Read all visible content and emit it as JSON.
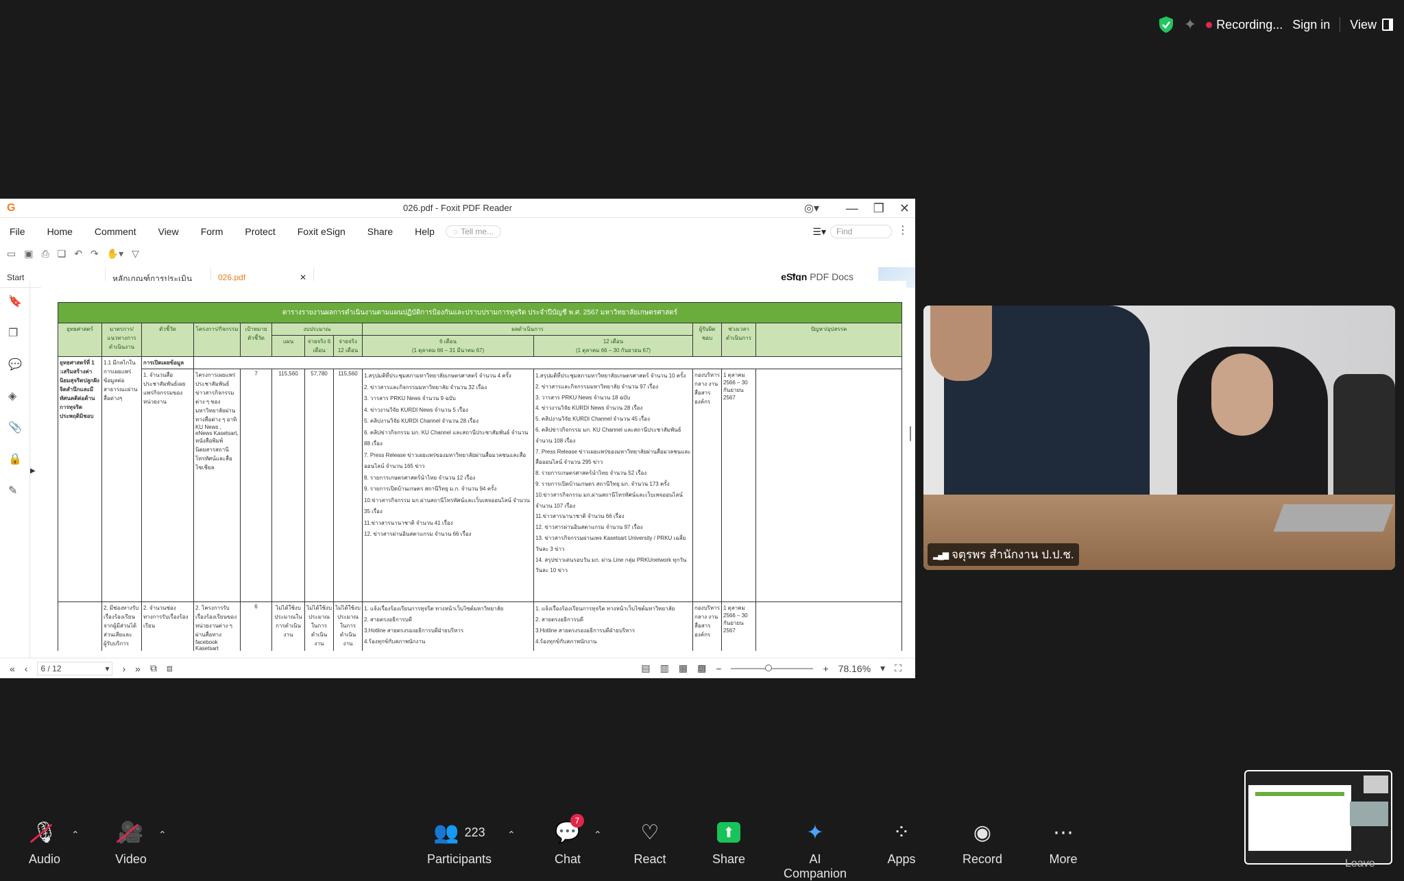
{
  "topbar": {
    "recording": "Recording...",
    "sign_in": "Sign in",
    "view": "View"
  },
  "foxit": {
    "title": "026.pdf - Foxit PDF Reader",
    "menu": [
      "File",
      "Home",
      "Comment",
      "View",
      "Form",
      "Protect",
      "Foxit eSign",
      "Share",
      "Help"
    ],
    "tell_me": "Tell me...",
    "find": "Find",
    "tabs": [
      "Start",
      "หลักเกณฑ์การประเมิน ITA ...",
      "026.pdf"
    ],
    "esign_brand": "eSign",
    "esign_rest": "PDF Docs",
    "page": "6 / 12",
    "zoom": "78.16%"
  },
  "pdf": {
    "title": "ตารางรายงานผลการดำเนินงานตามแผนปฏิบัติการป้องกันและปราบปรามการทุจริต ประจำปีบัญชี พ.ศ. 2567  มหาวิทยาลัยเกษตรศาสตร์",
    "headers": {
      "strategy": "ยุทธศาสตร์",
      "measure": "มาตรการ/แนวทางการดำเนินงาน",
      "indicator": "ตัวชี้วัด",
      "project": "โครงการ/กิจกรรม",
      "target": "เป้าหมายตัวชี้วัด",
      "budget": "งบประมาณ",
      "plan": "แผน",
      "spend6": "จ่ายจริง 6 เดือน",
      "spend12": "จ่ายจริง 12 เดือน",
      "result": "ผลดำเนินการ",
      "m6": "6 เดือน",
      "m6sub": "(1 ตุลาคม 66 – 31 มีนาคม 67)",
      "m12": "12 เดือน",
      "m12sub": "(1 ตุลาคม 66 – 30 กันยายน 67)",
      "owner": "ผู้รับผิดชอบ",
      "period": "ช่วงเวลาดำเนินการ",
      "problem": "ปัญหา/อุปสรรค"
    },
    "sub_row": {
      "measure": "1.1 มีกลไกในการเผยแพร่ข้อมูลต่อสาธารณะผ่านสื่อต่างๆ",
      "indicator": "การเปิดเผยข้อมูล"
    },
    "row1": {
      "strategy": "ยุทธศาสตร์ที่ 1 :เสริมสร้างค่านิยมสุจริตปลูกฝังจิตสำนึกและมีทัศนคติต่อต้านการทุจริตประพฤติมิชอบ",
      "indicator": "1. จำนวนสื่อประชาสัมพันธ์เผยแพร่กิจกรรมของหน่วยงาน",
      "project": "โครงการเผยแพร่ประชาสัมพันธ์ข่าวสารกิจกรรมต่าง ๆ ของมหาวิทยาลัยผ่านทางสื่อต่าง ๆ อาทิ KU News , eNews Kasetsart, หนังสือพิมพ์นิตยสารสถานีโทรทัศน์และสื่อโซเชียล",
      "target": "7",
      "plan": "115,560",
      "spend6": "57,780",
      "spend12": "115,560",
      "m6": "1.สรุปมติที่ประชุมสภามหาวิทยาลัยเกษตรศาสตร์ จำนวน 4 ครั้ง\n2. ข่าวสารและกิจกรรมมหาวิทยาลัย จำนวน 32 เรื่อง\n3. วารสาร PRKU News จำนวน 9 ฉบับ\n4. ข่าวงานวิจัย KURDI News จำนวน 5 เรื่อง\n5. คลิปงานวิจัย KURDI Channel จำนวน 28 เรื่อง\n6. คลิปข่าวกิจกรรม มก. KU Channel และสถานีประชาสัมพันธ์ จำนวน 88 เรื่อง\n7. Press Release ข่าวเผยแพร่ของมหาวิทยาลัยผ่านสื่อมวลชนและสื่อออนไลน์ จำนวน 165 ข่าว\n8. รายการเกษตรศาสตร์นำไทย จำนวน 12 เรื่อง\n9. รายการเปิดบ้านเกษตร สถานีวิทยุ ม.ก. จำนวน 94 ครั้ง\n10.ข่าวสารกิจกรรม มก.ผ่านสถานีโทรทัศน์และเว็บเพจออนไลน์ จำนวน 35 เรื่อง\n11.ข่าวสารนานาชาติ จำนวน 41 เรื่อง\n12. ข่าวสารผ่านอินสตาแกรม จำนวน 66 เรื่อง",
      "m12": "1.สรุปมติที่ประชุมสภามหาวิทยาลัยเกษตรศาสตร์ จำนวน 10 ครั้ง\n2. ข่าวสารและกิจกรรมมหาวิทยาลัย จำนวน 97 เรื่อง\n3. วารสาร PRKU News จำนวน 18 ฉบับ\n4. ข่าวงานวิจัย KURDI News จำนวน 28 เรื่อง\n5. คลิปงานวิจัย KURDI Channel จำนวน 45 เรื่อง\n6. คลิปข่าวกิจกรรม มก. KU Channel และสถานีประชาสัมพันธ์ จำนวน 108 เรื่อง\n7. Press Release ข่าวเผยแพร่ของมหาวิทยาลัยผ่านสื่อมวลชนและสื่อออนไลน์ จำนวน 295 ข่าว\n8. รายการเกษตรศาสตร์นำไทย จำนวน 52 เรื่อง\n9. รายการเปิดบ้านเกษตร สถานีวิทยุ มก. จำนวน 173 ครั้ง\n10.ข่าวสารกิจกรรม มก.ผ่านสถานีโทรทัศน์และเว็บเพจออนไลน์ จำนวน 107 เรื่อง\n11.ข่าวสารนานาชาติ จำนวน 66 เรื่อง\n12. ข่าวสารผ่านอินสตาแกรม จำนวน 97 เรื่อง\n13. ข่าวสารกิจกรรมผ่านเพจ Kasetsart University / PRKU เฉลี่ยวันละ 3 ข่าว\n14. สรุปข่าวเด่นรอบวัน มก. ผ่าน Line กลุ่ม PRKUnetwork ทุกวัน วันละ 10 ข่าว",
      "owner": "กองบริหารกลาง งานสื่อสารองค์กร",
      "period": "1 ตุลาคม 2566 – 30 กันยายน 2567"
    },
    "row2": {
      "measure": "2. มีช่องทางรับเรื่องร้องเรียนจากผู้มีส่วนได้ส่วนเสียและผู้รับบริการ",
      "indicator": "2. จำนวนช่องทางการรับเรื่องร้องเรียน",
      "project": "2. โครงการรับเรื่องร้องเรียนของหน่วยงานต่าง ๆ ผ่านสื่อทาง facebook Kasetsart",
      "target": "6",
      "plan": "ไม่ได้ใช้งบประมาณในการดำเนินงาน",
      "spend6": "ไม่ได้ใช้งบประมาณในการดำเนินงาน",
      "spend12": "ไม่ได้ใช้งบประมาณในการดำเนินงาน",
      "m6": "1. แจ้งเรื่องร้องเรียนการทุจริต ทางหน้าเว็บไซต์มหาวิทยาลัย\n2. สายตรงอธิการบดี\n3.Hotline สายตรงรองอธิการบดีฝ่ายบริหาร\n4.ร้องทุกข์กับสภาพนักงาน",
      "m12": "1. แจ้งเรื่องร้องเรียนการทุจริต ทางหน้าเว็บไซต์มหาวิทยาลัย\n2. สายตรงอธิการบดี\n3.Hotline สายตรงรองอธิการบดีฝ่ายบริหาร\n4.ร้องทุกข์กับสภาพนักงาน",
      "owner": "กองบริหารกลาง งานสื่อสารองค์กร",
      "period": "1 ตุลาคม 2566 – 30 กันยายน 2567"
    }
  },
  "video": {
    "name": "จตุรพร สำนักงาน ป.ป.ช."
  },
  "dock": {
    "audio": "Audio",
    "video": "Video",
    "participants": "Participants",
    "participants_count": "223",
    "chat": "Chat",
    "chat_badge": "7",
    "react": "React",
    "share": "Share",
    "ai": "AI Companion",
    "apps": "Apps",
    "record": "Record",
    "more": "More",
    "leave": "Leave"
  },
  "colors": {
    "pdf_header_green": "#6aad3d",
    "pdf_cell_green": "#cbe3b4",
    "share_green": "#18c35a",
    "accent_red": "#e0284a",
    "tab_orange": "#e67e22"
  }
}
